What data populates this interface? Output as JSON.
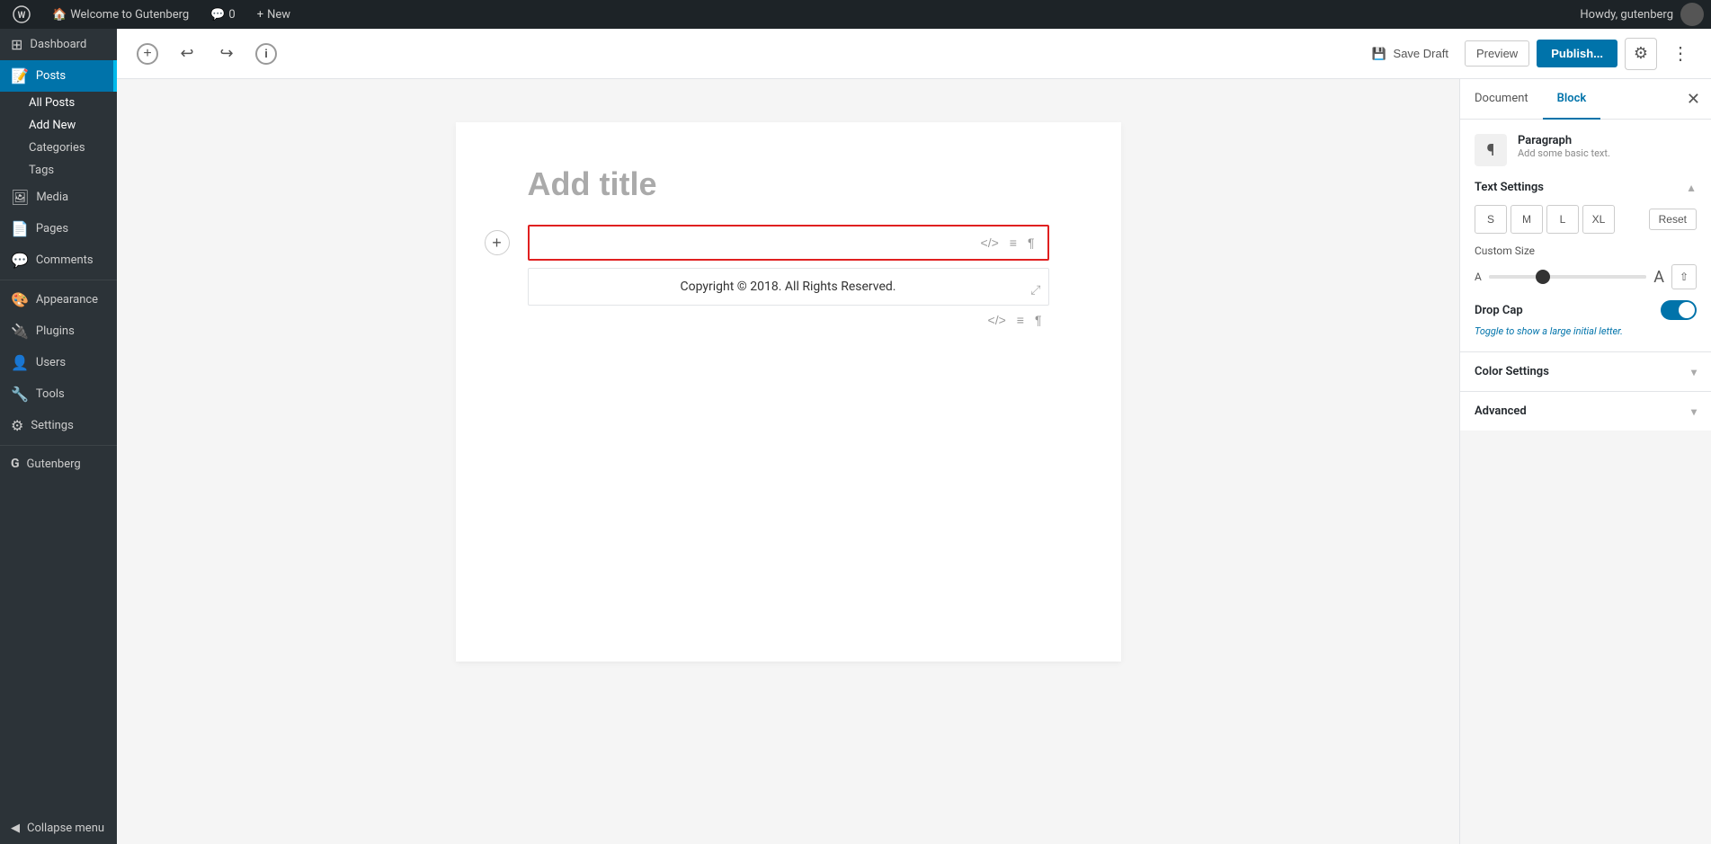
{
  "admin_bar": {
    "site_name": "Welcome to Gutenberg",
    "comments_count": "0",
    "new_label": "New",
    "howdy": "Howdy, gutenberg"
  },
  "sidebar": {
    "items": [
      {
        "id": "dashboard",
        "label": "Dashboard",
        "icon": "⊞"
      },
      {
        "id": "posts",
        "label": "Posts",
        "icon": "📝",
        "active": true
      },
      {
        "id": "media",
        "label": "Media",
        "icon": "🖼"
      },
      {
        "id": "pages",
        "label": "Pages",
        "icon": "📄"
      },
      {
        "id": "comments",
        "label": "Comments",
        "icon": "💬"
      },
      {
        "id": "appearance",
        "label": "Appearance",
        "icon": "🎨"
      },
      {
        "id": "plugins",
        "label": "Plugins",
        "icon": "🔌"
      },
      {
        "id": "users",
        "label": "Users",
        "icon": "👤"
      },
      {
        "id": "tools",
        "label": "Tools",
        "icon": "🔧"
      },
      {
        "id": "settings",
        "label": "Settings",
        "icon": "⚙"
      },
      {
        "id": "gutenberg",
        "label": "Gutenberg",
        "icon": "G"
      }
    ],
    "sub_items": [
      {
        "id": "all-posts",
        "label": "All Posts"
      },
      {
        "id": "add-new",
        "label": "Add New",
        "active": true
      },
      {
        "id": "categories",
        "label": "Categories"
      },
      {
        "id": "tags",
        "label": "Tags"
      }
    ],
    "collapse_label": "Collapse menu"
  },
  "toolbar": {
    "save_draft_label": "Save Draft",
    "preview_label": "Preview",
    "publish_label": "Publish...",
    "title_placeholder": "Add title"
  },
  "editor": {
    "title_placeholder": "Add title",
    "block1": {
      "placeholder": ""
    },
    "block2": {
      "content": "Copyright © 2018. All Rights Reserved."
    }
  },
  "right_panel": {
    "tab_document": "Document",
    "tab_block": "Block",
    "active_tab": "block",
    "block_type": {
      "icon": "¶",
      "name": "Paragraph",
      "description": "Add some basic text."
    },
    "text_settings": {
      "label": "Text Settings",
      "sizes": [
        "S",
        "M",
        "L",
        "XL"
      ],
      "reset_label": "Reset",
      "custom_size_label": "Custom Size"
    },
    "drop_cap": {
      "label": "Drop Cap",
      "hint": "Toggle to show a large initial letter.",
      "enabled": true
    },
    "color_settings": {
      "label": "Color Settings"
    },
    "advanced": {
      "label": "Advanced"
    }
  },
  "icons": {
    "wp_logo": "W",
    "undo": "↩",
    "redo": "↪",
    "info": "ℹ",
    "plus": "+",
    "slash_icon": "</>",
    "align_icon": "≡",
    "paragraph_icon": "¶",
    "resize_icon": "⤢",
    "settings_icon": "⚙",
    "more_icon": "⋮",
    "save_icon": "💾",
    "chevron_up": "▲",
    "chevron_down": "▾",
    "close": "✕",
    "spinner_right": "⇧"
  }
}
